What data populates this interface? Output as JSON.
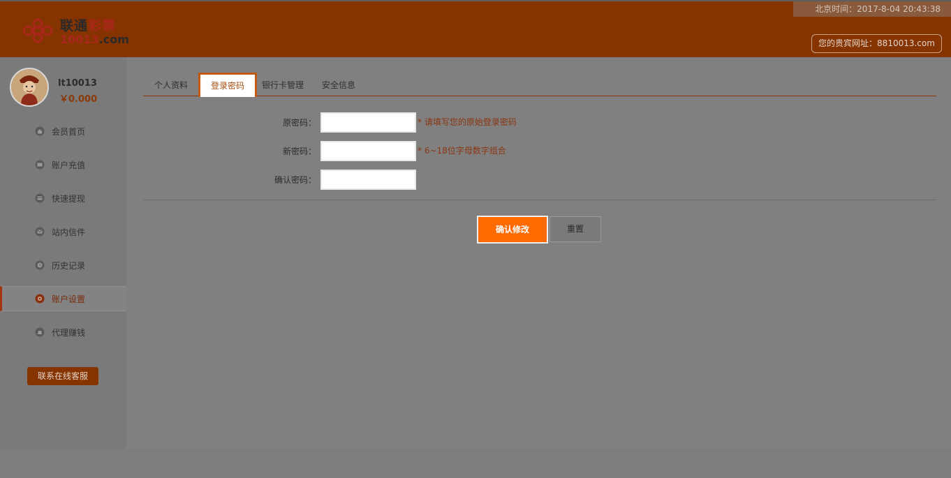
{
  "header": {
    "logo_cn_a": "联通",
    "logo_cn_b": "彩票",
    "logo_url_a": "10013",
    "logo_url_b": ".com",
    "clock": "北京时间：2017-8-04 20:43:38",
    "vip_url": "您的贵宾网址：8810013.com"
  },
  "user": {
    "name": "lt10013",
    "balance": "￥0.000"
  },
  "sidebar": {
    "items": [
      {
        "label": "会员首页",
        "icon": "home-icon"
      },
      {
        "label": "账户充值",
        "icon": "wallet-icon"
      },
      {
        "label": "快速提现",
        "icon": "card-icon"
      },
      {
        "label": "站内信件",
        "icon": "mail-icon"
      },
      {
        "label": "历史记录",
        "icon": "clock-icon"
      },
      {
        "label": "账户设置",
        "icon": "settings-icon",
        "active": true
      },
      {
        "label": "代理赚钱",
        "icon": "money-bag-icon"
      }
    ],
    "service_button": "联系在线客服"
  },
  "tabs": [
    {
      "label": "个人资料"
    },
    {
      "label": "登录密码",
      "active": true
    },
    {
      "label": "银行卡管理"
    },
    {
      "label": "安全信息"
    }
  ],
  "form": {
    "old_password": {
      "label": "原密码：",
      "value": "",
      "hint": "* 请填写您的原始登录密码"
    },
    "new_password": {
      "label": "新密码：",
      "value": "",
      "hint": "* 6~18位字母数字组合"
    },
    "confirm_password": {
      "label": "确认密码：",
      "value": ""
    },
    "confirm_button": "确认修改",
    "reset_button": "重置"
  },
  "colors": {
    "brand": "#853400",
    "accent": "#ff6a00",
    "overlay_gray": "#808080"
  }
}
